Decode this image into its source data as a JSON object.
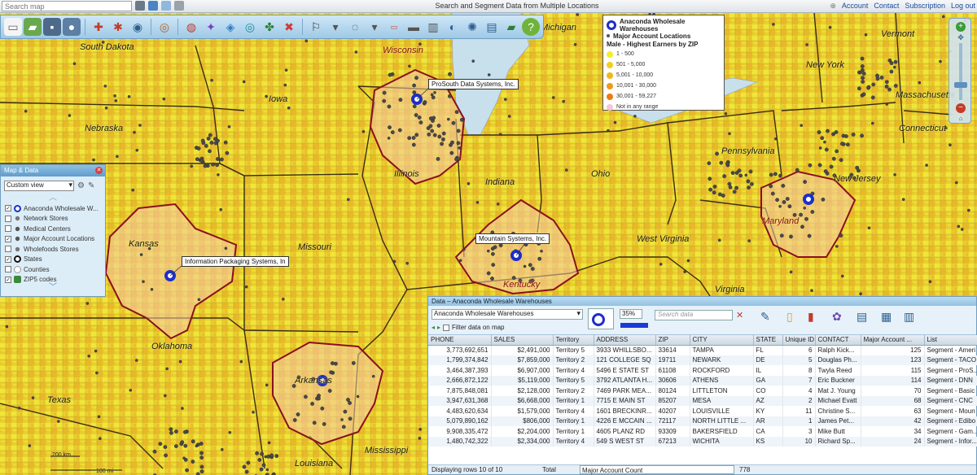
{
  "topbar": {
    "search_placeholder": "Search map",
    "title": "Search and Segment Data from Multiple Locations",
    "links": [
      "Account",
      "Contact",
      "Subscription",
      "Log out"
    ]
  },
  "map": {
    "state_labels": [
      "South Dakota",
      "Nebraska",
      "Kansas",
      "Oklahoma",
      "Texas",
      "Iowa",
      "Missouri",
      "Arkansas",
      "Louisiana",
      "Mississippi",
      "Wisconsin",
      "Illinois",
      "Indiana",
      "Ohio",
      "Kentucky",
      "West Virginia",
      "Virginia",
      "Pennsylvania",
      "New York",
      "New Jersey",
      "Maryland",
      "Vermont",
      "Massachusetts",
      "Connecticut",
      "Michigan"
    ],
    "callouts": [
      "ProSouth Data Systems, Inc.",
      "Mountain Systems, Inc.",
      "Information Packaging Systems, In"
    ],
    "scale_labels": [
      "200 km",
      "100 mi"
    ]
  },
  "legend": {
    "items": [
      {
        "label": "Anaconda Wholesale Warehouses",
        "kind": "ring",
        "color": "#1d2fc8"
      },
      {
        "label": "Major Account Locations",
        "kind": "dot",
        "color": "#555555"
      }
    ],
    "range_title": "Male - Highest Earners by ZIP",
    "ranges": [
      {
        "label": "1 - 500",
        "color": "#f2ef2a"
      },
      {
        "label": "501 - 5,000",
        "color": "#f0d020"
      },
      {
        "label": "5,001 - 10,000",
        "color": "#efb61c"
      },
      {
        "label": "10,001 - 30,000",
        "color": "#ef9a17"
      },
      {
        "label": "30,001 - 59,227",
        "color": "#ee7a12"
      },
      {
        "label": "Not in any range",
        "color": "#f3c6dc"
      }
    ]
  },
  "map_data_panel": {
    "title": "Map & Data",
    "view": "Custom view",
    "layers": [
      {
        "label": "Anaconda Wholesale W...",
        "checked": true,
        "icon": "ring"
      },
      {
        "label": "Network Stores",
        "checked": false,
        "icon": "dot"
      },
      {
        "label": "Medical Centers",
        "checked": false,
        "icon": "dot"
      },
      {
        "label": "Major Account Locations",
        "checked": true,
        "icon": "dot"
      },
      {
        "label": "Wholefoods Stores",
        "checked": false,
        "icon": "dot"
      },
      {
        "label": "States",
        "checked": true,
        "icon": "ring-black"
      },
      {
        "label": "Counties",
        "checked": false,
        "icon": "ring-gray"
      },
      {
        "label": "ZIP5 codes",
        "checked": true,
        "icon": "pencil"
      }
    ]
  },
  "data_panel": {
    "title": "Data – Anaconda Wholesale Warehouses",
    "layer": "Anaconda Wholesale Warehouses",
    "opacity": "35%",
    "search_placeholder": "Search data",
    "filter_label": "Filter data on map",
    "columns": [
      "PHONE",
      "SALES",
      "Territory",
      "ADDRESS",
      "ZIP",
      "CITY",
      "STATE",
      "Unique ID",
      "CONTACT",
      "Major Account ...",
      "List"
    ],
    "rows": [
      [
        "3,773,692,651",
        "$2,491,000",
        "Territory 5",
        "3933 WHILLSBO...",
        "33614",
        "TAMPA",
        "FL",
        "6",
        "Ralph Kick...",
        "125",
        "Segment - Ameri"
      ],
      [
        "1,799,374,842",
        "$7,859,000",
        "Territory 2",
        "121 COLLEGE SQ",
        "19711",
        "NEWARK",
        "DE",
        "5",
        "Douglas Ph...",
        "123",
        "Segment - TACO"
      ],
      [
        "3,464,387,393",
        "$6,907,000",
        "Territory 4",
        "5496 E STATE ST",
        "61108",
        "ROCKFORD",
        "IL",
        "8",
        "Twyla Reed",
        "115",
        "Segment - ProS..."
      ],
      [
        "2,666,872,122",
        "$5,119,000",
        "Territory 5",
        "3792 ATLANTA H...",
        "30606",
        "ATHENS",
        "GA",
        "7",
        "Eric Buckner",
        "114",
        "Segment - DNN"
      ],
      [
        "7,875,848,081",
        "$2,128,000",
        "Territory 2",
        "7469 PARK MEA...",
        "80124",
        "LITTLETON",
        "CO",
        "4",
        "Mat J. Young",
        "70",
        "Segment - Basic"
      ],
      [
        "3,947,631,368",
        "$6,668,000",
        "Territory 1",
        "7715 E MAIN ST",
        "85207",
        "MESA",
        "AZ",
        "2",
        "Michael Evatt",
        "68",
        "Segment - CNC"
      ],
      [
        "4,483,620,634",
        "$1,579,000",
        "Territory 4",
        "1601 BRECKINR...",
        "40207",
        "LOUISVILLE",
        "KY",
        "11",
        "Christine S...",
        "63",
        "Segment - Moun"
      ],
      [
        "5,079,890,162",
        "$806,000",
        "Territory 1",
        "4226 E MCCAIN ...",
        "72117",
        "NORTH LITTLE ...",
        "AR",
        "1",
        "James Pet...",
        "42",
        "Segment - Edibo"
      ],
      [
        "9,908,335,472",
        "$2,204,000",
        "Territory 1",
        "4605 PLANZ RD",
        "93309",
        "BAKERSFIELD",
        "CA",
        "3",
        "Mike Butt",
        "34",
        "Segment - Gam..."
      ],
      [
        "1,480,742,322",
        "$2,334,000",
        "Territory 4",
        "549 S WEST ST",
        "67213",
        "WICHITA",
        "KS",
        "10",
        "Richard Sp...",
        "24",
        "Segment - Infor..."
      ]
    ],
    "footer_rows": "Displaying rows 10 of 10",
    "footer_total_label": "Total",
    "footer_total_field": "Major Account Count",
    "footer_total_value": "778"
  },
  "colors": {
    "warehouse_ring": "#1d2fc8",
    "territory_border": "#8a1020",
    "territory_fill": "#f4c9a8",
    "lake": "#c8dfec"
  }
}
